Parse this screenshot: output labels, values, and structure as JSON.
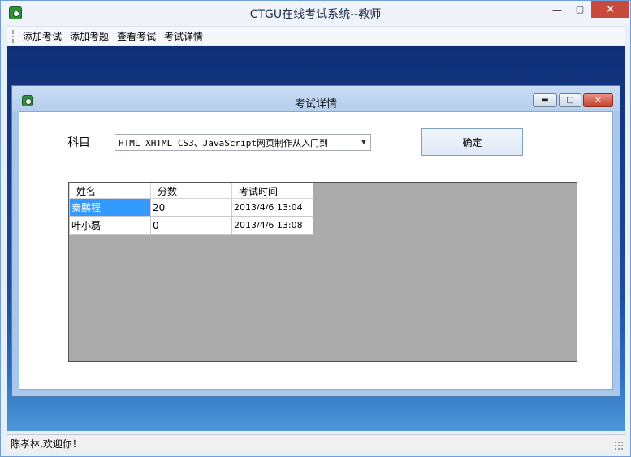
{
  "window": {
    "title": "CTGU在线考试系统--教师"
  },
  "menu": {
    "items": [
      "添加考试",
      "添加考题",
      "查看考试",
      "考试详情"
    ]
  },
  "child": {
    "title": "考试详情",
    "subject_label": "科目",
    "subject_value": "HTML XHTML CS3、JavaScript网页制作从入门到",
    "ok_label": "确定"
  },
  "grid": {
    "headers": [
      "姓名",
      "分数",
      "考试时间"
    ],
    "rows": [
      [
        "秦鹏程",
        "20",
        "2013/4/6 13:04"
      ],
      [
        "叶小磊",
        "0",
        "2013/4/6 13:08"
      ]
    ]
  },
  "status": {
    "text": "陈孝林,欢迎你！"
  }
}
